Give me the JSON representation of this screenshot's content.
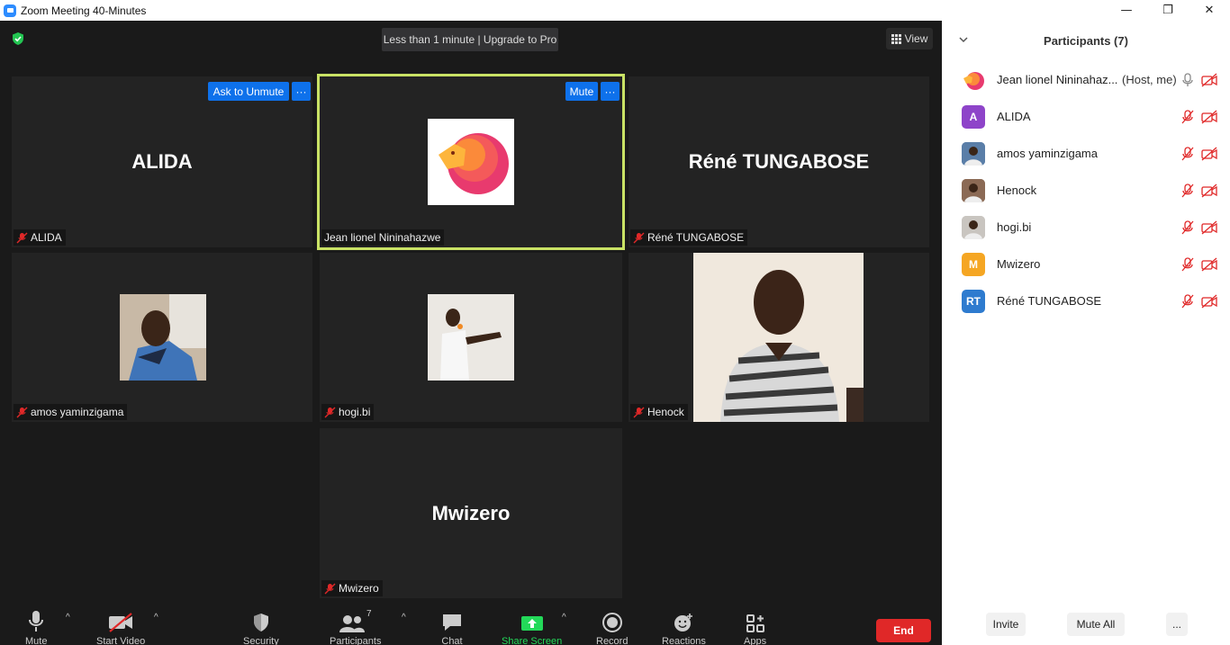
{
  "window": {
    "title": "Zoom Meeting 40-Minutes",
    "minimize_glyph": "—",
    "restore_glyph": "❐",
    "close_glyph": "✕"
  },
  "meeting": {
    "timer_banner": "Less than 1 minute | Upgrade to Pro",
    "view_label": "View",
    "tiles": {
      "alida": {
        "big_name": "ALIDA",
        "tag": "ALIDA",
        "button": "Ask to Unmute"
      },
      "jean": {
        "tag": "Jean lionel Nininahazwe",
        "button": "Mute"
      },
      "rene": {
        "big_name": "Réné TUNGABOSE",
        "tag": "Réné TUNGABOSE"
      },
      "amos": {
        "tag": "amos yaminzigama"
      },
      "hogi": {
        "tag": "hogi.bi"
      },
      "henock": {
        "tag": "Henock"
      },
      "mwizero": {
        "big_name": "Mwizero",
        "tag": "Mwizero"
      }
    },
    "more_glyph": "···"
  },
  "toolbar": {
    "mute": "Mute",
    "start_video": "Start Video",
    "security": "Security",
    "participants": "Participants",
    "participants_count": "7",
    "chat": "Chat",
    "share_screen": "Share Screen",
    "record": "Record",
    "reactions": "Reactions",
    "apps": "Apps",
    "end": "End",
    "caret": "^"
  },
  "panel": {
    "title": "Participants (7)",
    "participants": [
      {
        "name": "Jean lionel Nininahaz...",
        "role": "(Host, me)",
        "initials": "",
        "color": "#ffffff"
      },
      {
        "name": "ALIDA",
        "initials": "A",
        "color": "#8e44c9"
      },
      {
        "name": "amos yaminzigama",
        "initials": "",
        "color": "#5a7ea8"
      },
      {
        "name": "Henock",
        "initials": "",
        "color": "#8b6a55"
      },
      {
        "name": "hogi.bi",
        "initials": "",
        "color": "#c9c5c0"
      },
      {
        "name": "Mwizero",
        "initials": "M",
        "color": "#f5a623"
      },
      {
        "name": "Réné TUNGABOSE",
        "initials": "RT",
        "color": "#2e7bcf"
      }
    ],
    "invite": "Invite",
    "mute_all": "Mute All",
    "more": "..."
  },
  "colors": {
    "accent_blue": "#0e71eb",
    "end_red": "#e02828",
    "share_green": "#23d959",
    "active_speaker": "#c9e265",
    "muted_red": "#e02828"
  }
}
